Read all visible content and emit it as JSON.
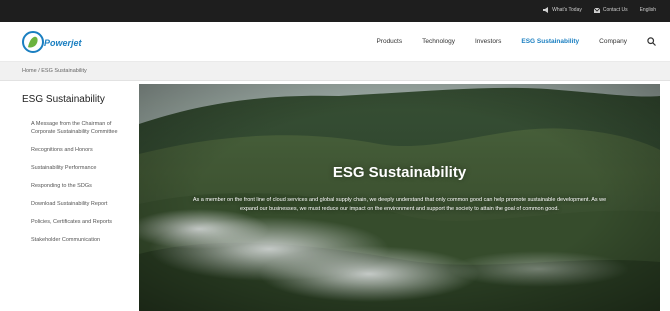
{
  "utility": {
    "whats_new": "What's Today",
    "contact": "Contact Us",
    "language": "English"
  },
  "brand": {
    "logo_text": "Powerjet",
    "accent": "#1a7fc1",
    "logo_green": "#6cb33f"
  },
  "nav": {
    "items": [
      "Products",
      "Technology",
      "Investors",
      "ESG Sustainability",
      "Company"
    ],
    "active_index": 3
  },
  "breadcrumb": {
    "text": "Home / ESG Sustainability"
  },
  "sidebar": {
    "title": "ESG Sustainability",
    "items": [
      "A Message from the Chairman of Corporate Sustainability Committee",
      "Recognitions and Honors",
      "Sustainability Performance",
      "Responding to the SDGs",
      "Download Sustainability Report",
      "Policies, Certificates and Reports",
      "Stakeholder Communication"
    ]
  },
  "hero": {
    "title": "ESG Sustainability",
    "body": "As a member on the front line of cloud services and global supply chain, we deeply understand that only common good can help promote sustainable development. As we expand our businesses, we must reduce our impact on the environment and support the society to attain the goal of common good."
  }
}
